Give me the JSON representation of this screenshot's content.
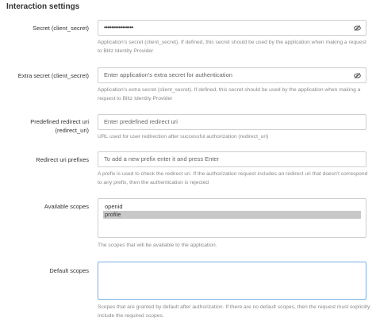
{
  "section": {
    "title": "Interaction settings"
  },
  "secret": {
    "label": "Secret (client_secret)",
    "value": "••••••••••••••••",
    "help": "Application's secret (client_secret). If defined, this secret should be used by the application when making a request to Blitz Identity Provider"
  },
  "extra_secret": {
    "label": "Extra secret (client_secret)",
    "placeholder": "Enter application's extra secret for authentication",
    "help": "Application's extra secret (client_secret). If defined, this secret should be used by the application when making a request to Blitz Identity Provider"
  },
  "redirect_uri": {
    "label_line1": "Predefined redirect uri",
    "label_line2": "(redirect_uri)",
    "placeholder": "Enter predefined redirect uri",
    "help": "URL used for user redirection after successful authorization (redirect_uri)"
  },
  "redirect_prefixes": {
    "label": "Redirect uri prefixes",
    "placeholder": "To add a new prefix enter it and press Enter",
    "help": "A prefix is used to check the redirect uri. If the authorization request includes an redirect uri that doesn't correspond to any prefix, then the authentication is rejected"
  },
  "available_scopes": {
    "label": "Available scopes",
    "items": [
      "openid",
      "profile"
    ],
    "selected": "profile",
    "help": "The scopes that will be available to the application."
  },
  "default_scopes": {
    "label": "Default scopes",
    "value": "",
    "help": "Scopes that are granted by default after authorization. If there are no default scopes, then the request must explicitly include the required scopes."
  },
  "icons": {
    "toggle_visibility": "eye-slash-icon"
  },
  "colors": {
    "focus_border": "#7ab0e0",
    "selected_bg": "#c8c8c8",
    "help_text": "#8a8a8a"
  }
}
